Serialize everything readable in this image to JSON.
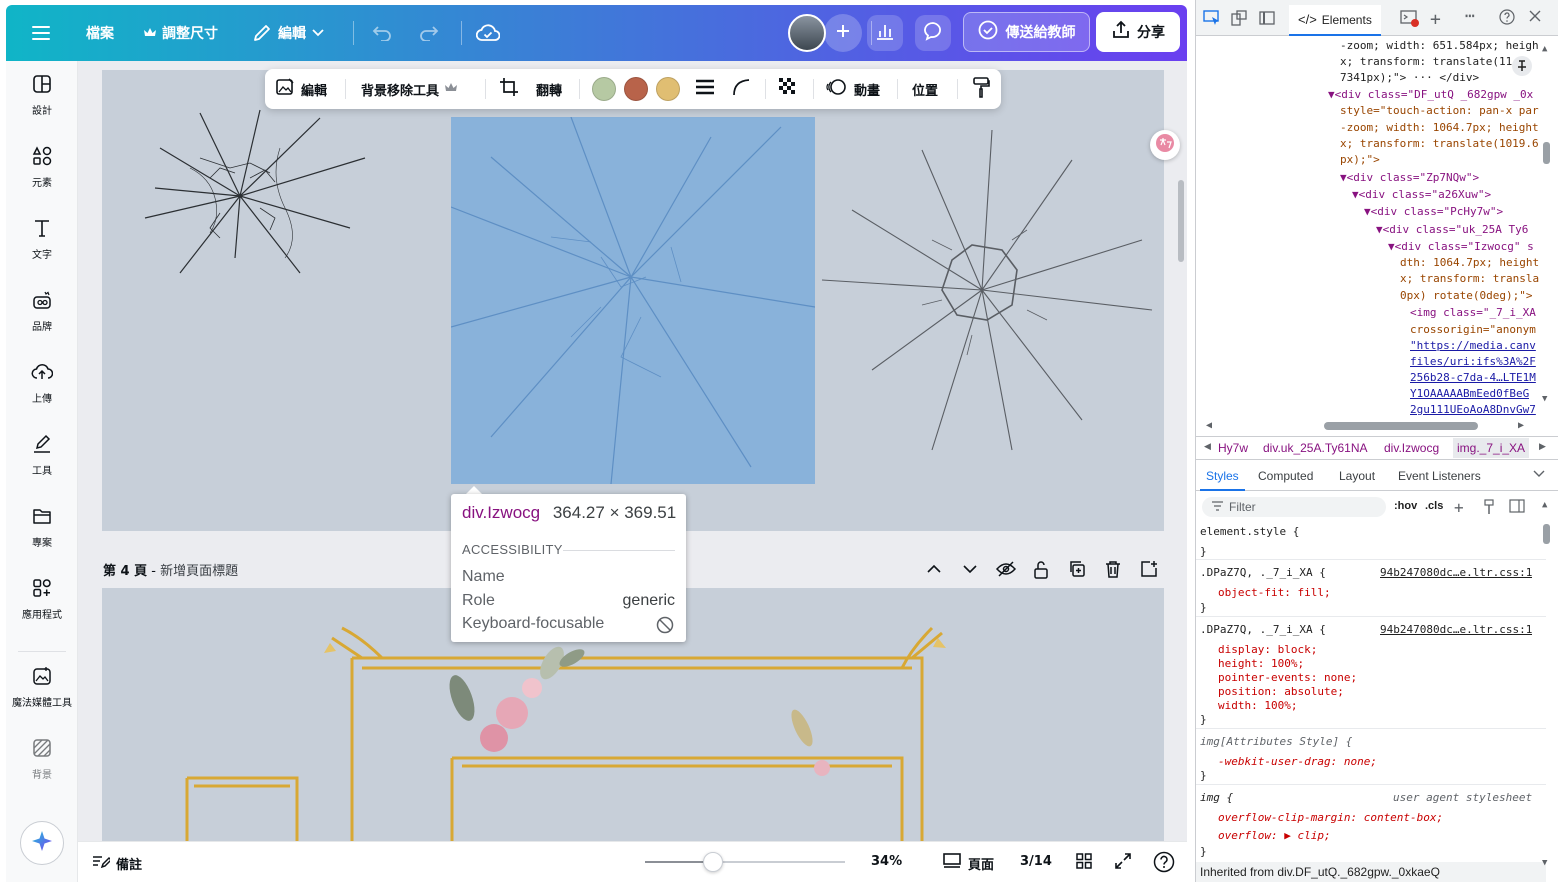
{
  "topbar": {
    "file": "檔案",
    "resize": "調整尺寸",
    "edit": "編輯",
    "send_teacher": "傳送給教師",
    "share": "分享"
  },
  "sidebar": {
    "items": [
      {
        "label": "設計",
        "icon": "layout-icon"
      },
      {
        "label": "元素",
        "icon": "shapes-icon"
      },
      {
        "label": "文字",
        "icon": "text-icon"
      },
      {
        "label": "品牌",
        "icon": "brand-icon"
      },
      {
        "label": "上傳",
        "icon": "upload-cloud-icon"
      },
      {
        "label": "工具",
        "icon": "pen-tool-icon"
      },
      {
        "label": "專案",
        "icon": "folder-icon"
      },
      {
        "label": "應用程式",
        "icon": "apps-grid-icon"
      },
      {
        "label": "魔法媒體工具",
        "icon": "magic-media-icon"
      },
      {
        "label": "背景",
        "icon": "background-pattern-icon"
      }
    ]
  },
  "float_toolbar": {
    "edit": "編輯",
    "bg_remover": "背景移除工具",
    "flip": "翻轉",
    "animate": "動畫",
    "position": "位置",
    "swatches": [
      "#b6c9a3",
      "#b8634a",
      "#e0be72"
    ]
  },
  "page4": {
    "page_number": "第 4 頁",
    "separator": " - ",
    "title_placeholder": "新增頁面標題"
  },
  "inspector": {
    "element": "div.Izwocg",
    "size": "364.27 × 369.51",
    "section": "ACCESSIBILITY",
    "name_label": "Name",
    "role_label": "Role",
    "role_value": "generic",
    "focus_label": "Keyboard-focusable"
  },
  "bottombar": {
    "notes": "備註",
    "zoom": "34%",
    "zoom_fraction": 0.34,
    "pages_label": "頁面",
    "page_count": "3/14"
  },
  "devtools": {
    "tab_elements": "Elements",
    "code_lines": [
      "-zoom; width: 651.584px; heigh",
      "x; transform: translate(11",
      "7341px);\"> ··· </div>",
      "▼<div class=\"DF_utQ _682gpw _0x",
      "style=\"touch-action: pan-x par",
      "-zoom; width: 1064.7px; height",
      "x; transform: translate(1019.6",
      "px);\">",
      "▼<div class=\"Zp7NQw\">",
      "▼<div class=\"a26Xuw\">",
      "▼<div class=\"PcHy7w\">",
      "▼<div class=\"uk_25A Ty6",
      "▼<div class=\"Izwocg\" s",
      "dth: 1064.7px; height",
      "x; transform: transla",
      "0px) rotate(0deg);\">",
      "<img class=\"_7_i_XA",
      "crossorigin=\"anonym",
      "\"https://media.canv",
      "files/uri:ifs%3A%2F",
      "256b28-c7da-4…LTE1M",
      "Y1OAAAAABmEed0fBeG",
      "2gu111UEoAoA8DnvGw7"
    ],
    "breadcrumbs": [
      "Hy7w",
      "div.uk_25A.Ty61NA",
      "div.Izwocg",
      "img._7_i_XA"
    ],
    "style_tabs": [
      "Styles",
      "Computed",
      "Layout",
      "Event Listeners"
    ],
    "filter_placeholder": "Filter",
    "hov": ":hov",
    "cls": ".cls",
    "rules": {
      "element_style": "element.style {",
      "close": "}",
      "rule1_selector": ".DPaZ7Q, ._7_i_XA {",
      "rule1_source": "94b247080dc…e.ltr.css:1",
      "rule1_decl": "object-fit: fill;",
      "rule2_selector": ".DPaZ7Q, ._7_i_XA {",
      "rule2_source": "94b247080dc…e.ltr.css:1",
      "rule2_decls": [
        "display: block;",
        "height: 100%;",
        "pointer-events: none;",
        "position: absolute;",
        "width: 100%;"
      ],
      "rule3_selector": "img[Attributes Style] {",
      "rule3_decl": "-webkit-user-drag: none;",
      "rule4_selector": "img {",
      "rule4_source": "user agent stylesheet",
      "rule4_decls": [
        "overflow-clip-margin: content-box;",
        "overflow: ▶ clip;"
      ],
      "inherited": "Inherited from div.DF_utQ._682gpw._0xkaeQ"
    }
  }
}
